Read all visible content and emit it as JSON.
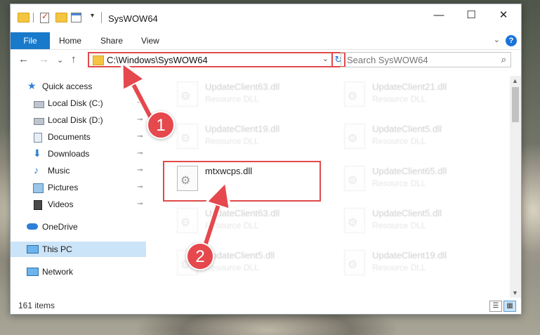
{
  "window": {
    "title": "SysWOW64",
    "controls": {
      "minimize": "—",
      "maximize": "☐",
      "close": "✕"
    }
  },
  "ribbon": {
    "tabs": [
      "File",
      "Home",
      "Share",
      "View"
    ],
    "collapse_glyph": "⌄",
    "help_glyph": "?"
  },
  "nav": {
    "back": "←",
    "forward": "→",
    "recent": "⌄",
    "up": "↑",
    "address": "C:\\Windows\\SysWOW64",
    "dropdown": "⌄",
    "refresh": "↻",
    "search_placeholder": "Search SysWOW64",
    "search_glyph": "⌕"
  },
  "sidebar": {
    "items": [
      {
        "label": "Quick access",
        "icon": "star-icon",
        "pinned": false
      },
      {
        "label": "Local Disk (C:)",
        "icon": "drive-icon",
        "pinned": true
      },
      {
        "label": "Local Disk (D:)",
        "icon": "drive-icon",
        "pinned": true
      },
      {
        "label": "Documents",
        "icon": "documents-icon",
        "pinned": true
      },
      {
        "label": "Downloads",
        "icon": "downloads-icon",
        "pinned": true
      },
      {
        "label": "Music",
        "icon": "music-icon",
        "pinned": true
      },
      {
        "label": "Pictures",
        "icon": "pictures-icon",
        "pinned": true
      },
      {
        "label": "Videos",
        "icon": "videos-icon",
        "pinned": true
      },
      {
        "label": "OneDrive",
        "icon": "onedrive-icon",
        "pinned": false
      },
      {
        "label": "This PC",
        "icon": "this-pc-icon",
        "pinned": false,
        "selected": true
      },
      {
        "label": "Network",
        "icon": "network-icon",
        "pinned": false
      }
    ],
    "pin_glyph": "📌"
  },
  "files": [
    {
      "name": "UpdateClient63.dll",
      "type": "Resource DLL",
      "faded": true
    },
    {
      "name": "UpdateClient21.dll",
      "type": "Resource DLL",
      "faded": true
    },
    {
      "name": "UpdateClient19.dll",
      "type": "Resource DLL",
      "faded": true
    },
    {
      "name": "UpdateClient5.dll",
      "type": "Resource DLL",
      "faded": true
    },
    {
      "name": "mtxwcps.dll",
      "type": "",
      "faded": false
    },
    {
      "name": "UpdateClient65.dll",
      "type": "Resource DLL",
      "faded": true
    },
    {
      "name": "UpdateClient63.dll",
      "type": "Resource DLL",
      "faded": true
    },
    {
      "name": "UpdateClient5.dll",
      "type": "Resource DLL",
      "faded": true
    },
    {
      "name": "UpdateClient5.dll",
      "type": "Resource DLL",
      "faded": true
    },
    {
      "name": "UpdateClient19.dll",
      "type": "Resource DLL",
      "faded": true
    }
  ],
  "status": {
    "items_count": "161 items"
  },
  "callouts": [
    "1",
    "2"
  ],
  "colors": {
    "accent": "#1979ca",
    "highlight": "#e04a4a",
    "callout": "#e5484d",
    "selection": "#cce4f7"
  }
}
